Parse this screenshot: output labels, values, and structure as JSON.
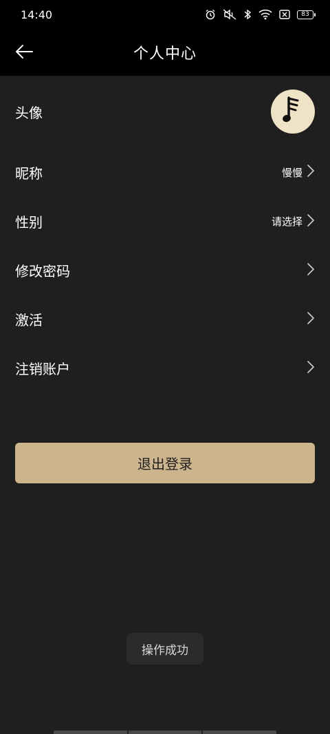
{
  "status_bar": {
    "time": "14:40",
    "icons": [
      "alarm-icon",
      "mute-icon",
      "bluetooth-icon",
      "wifi-icon",
      "sim-icon",
      "battery-icon"
    ],
    "battery": "83"
  },
  "header": {
    "back_icon": "arrow-left-icon",
    "title": "个人中心"
  },
  "profile": {
    "avatar_label": "头像",
    "avatar_icon": "music-note-icon",
    "nickname_label": "昵称",
    "nickname_value": "慢慢",
    "gender_label": "性别",
    "gender_value": "请选择",
    "change_password_label": "修改密码",
    "activate_label": "激活",
    "delete_account_label": "注销账户"
  },
  "logout_button": "退出登录",
  "toast": "操作成功",
  "colors": {
    "background": "#1f1f1f",
    "header": "#000000",
    "accent": "#ccb48c",
    "avatar_bg": "#efe3c5"
  }
}
